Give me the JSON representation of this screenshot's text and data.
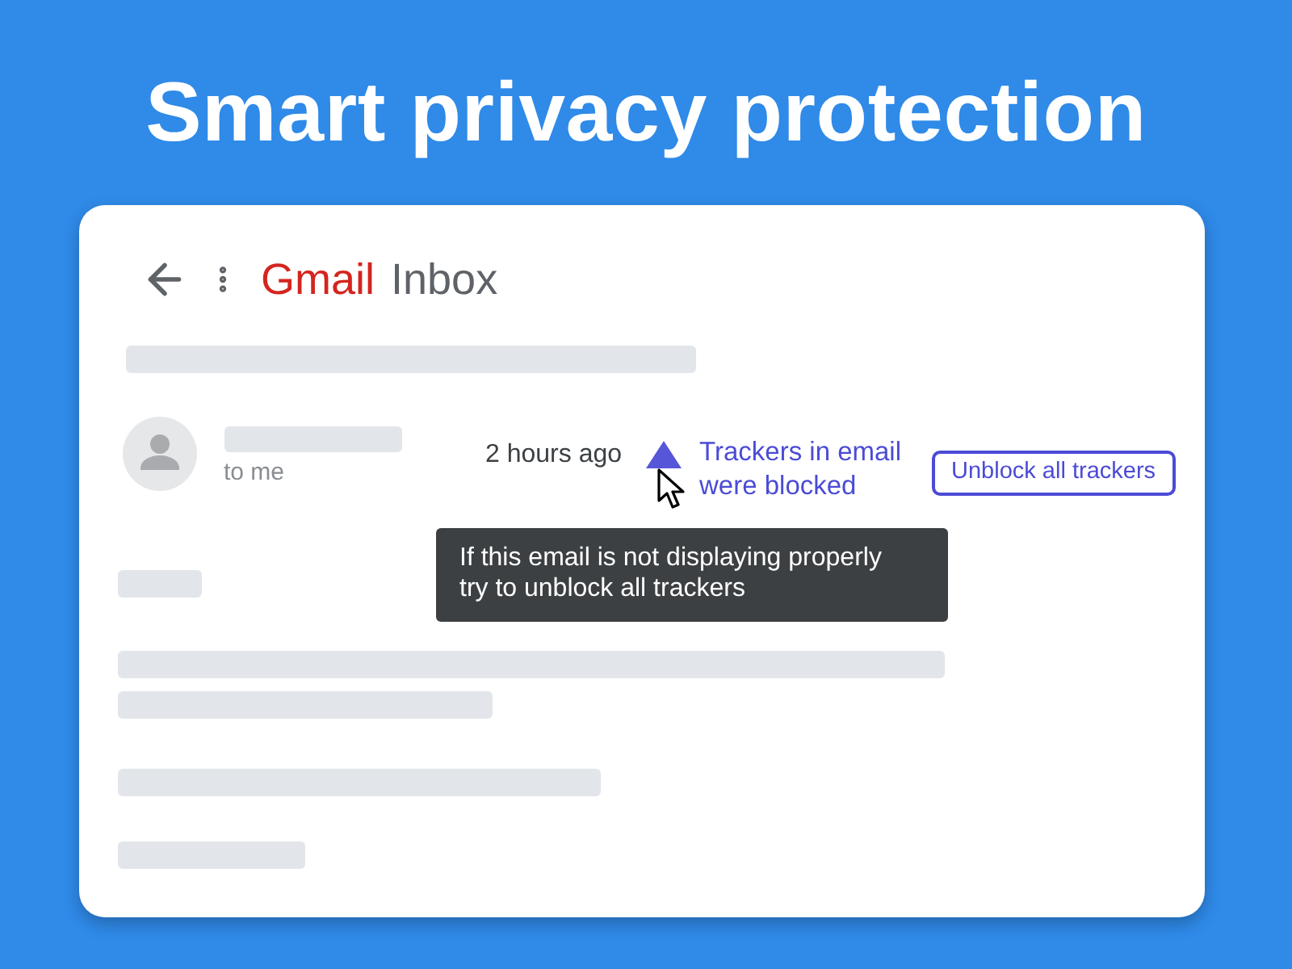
{
  "headline": "Smart privacy protection",
  "app_bar": {
    "brand": "Gmail",
    "folder": "Inbox"
  },
  "message": {
    "recipient": "to me",
    "time": "2 hours ago",
    "tracker_notice": "Trackers in email were blocked",
    "unblock_button": "Unblock all trackers"
  },
  "tooltip": "If this email is not displaying properly try to unblock all trackers"
}
